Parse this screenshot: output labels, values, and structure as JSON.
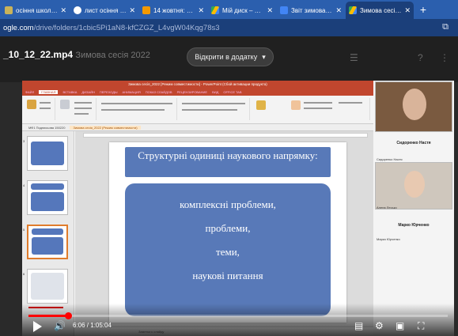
{
  "browser": {
    "tabs": [
      {
        "label": "осіння школа - 1",
        "icon": "school-icon",
        "color": "#c9b35a"
      },
      {
        "label": "лист осіння сесі",
        "icon": "globe-icon",
        "color": "#ffffff"
      },
      {
        "label": "14 жовтня: сесі",
        "icon": "notion-icon",
        "color": "#f29900"
      },
      {
        "label": "Мій диск – Goo",
        "icon": "drive-icon",
        "color": "#34a853"
      },
      {
        "label": "Звіт зимова сесі",
        "icon": "sheets-icon",
        "color": "#4285f4"
      },
      {
        "label": "Зимова сесія_М",
        "icon": "drive-icon",
        "color": "#34a853"
      }
    ],
    "new_tab": "+",
    "url_domain": "ogle.com",
    "url_path": "/drive/folders/1cbic5Pi1aN8-kfCZGZ_L4vgW04Kqg78s3"
  },
  "viewer": {
    "filename": "_10_12_22.mp4",
    "filename_suffix": "Зимова сесія 2022",
    "open_with": "Відкрити в додатку"
  },
  "ppt": {
    "window_title": "Зимова сесія_2022 [Режим совместимости] - PowerPoint (Сбой активации продукта)",
    "ribbon_tabs": [
      "ФАЙЛ",
      "ГЛАВНАЯ",
      "ВСТАВКА",
      "ДИЗАЙН",
      "ПЕРЕХОДЫ",
      "АНИМАЦИЯ",
      "ПОКАЗ СЛАЙДОВ",
      "РЕЦЕНЗИРОВАНИЕ",
      "ВИД",
      "OFFICE TAB"
    ],
    "doc_tabs": [
      "МФ1 Подписьова 150220",
      "Зимова сесія_2022 (Режим совместимости)"
    ],
    "slide_title": "Структурні одиниці наукового напрямку:",
    "slide_items": [
      "комплексні проблеми,",
      "проблеми,",
      "теми,",
      "наукові питання"
    ],
    "notes_placeholder": "Заметки к слайду",
    "thumb_numbers": [
      "3",
      "4",
      "5",
      "6"
    ]
  },
  "participants": [
    {
      "name": "Сидоренко Настя",
      "tag": "Сидоренко Настя"
    },
    {
      "name": "Марко Юрченко",
      "tag": "Алена Лесько",
      "tag2": "Марко Юрченко"
    }
  ],
  "player": {
    "time": "6:06 / 1:05:04",
    "progress": 0.094
  }
}
